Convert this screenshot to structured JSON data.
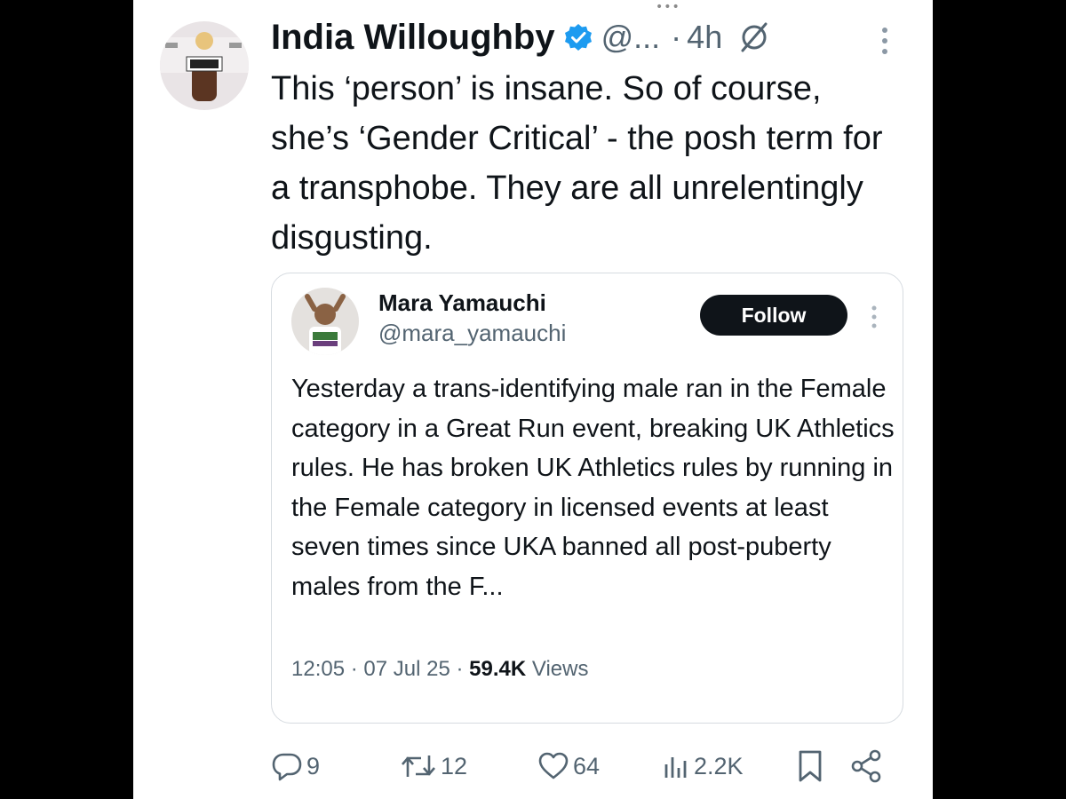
{
  "post": {
    "author_name": "India Willoughby",
    "handle": "@...",
    "separator": "·",
    "time": "4h",
    "text": "This ‘person’ is insane. So of course, she’s ‘Gender Critical’ - the posh term for a transphobe. They are all unrelentingly disgusting."
  },
  "quote": {
    "author_name": "Mara Yamauchi",
    "handle": "@mara_yamauchi",
    "follow_label": "Follow",
    "text": "Yesterday a trans-identifying male ran in the Female category in a Great Run event, breaking UK Athletics rules. He has broken UK Athletics rules by running in the Female category in licensed events at least seven times since UKA banned all post-puberty males from the F...",
    "time": "12:05",
    "date": "07 Jul 25",
    "separator": "·",
    "views_count": "59.4K",
    "views_label": "Views"
  },
  "actions": {
    "replies": "9",
    "reposts": "12",
    "likes": "64",
    "views": "2.2K"
  },
  "icons": {
    "verified": "verified-badge-icon",
    "grok": "grok-icon",
    "more": "more-vertical-icon",
    "reply": "reply-icon",
    "repost": "repost-icon",
    "like": "like-icon",
    "views": "views-icon",
    "bookmark": "bookmark-icon",
    "share": "share-icon"
  },
  "colors": {
    "accent": "#1d9bf0",
    "text": "#0f1419",
    "secondary": "#536471",
    "follow_button": "#0f1419"
  }
}
